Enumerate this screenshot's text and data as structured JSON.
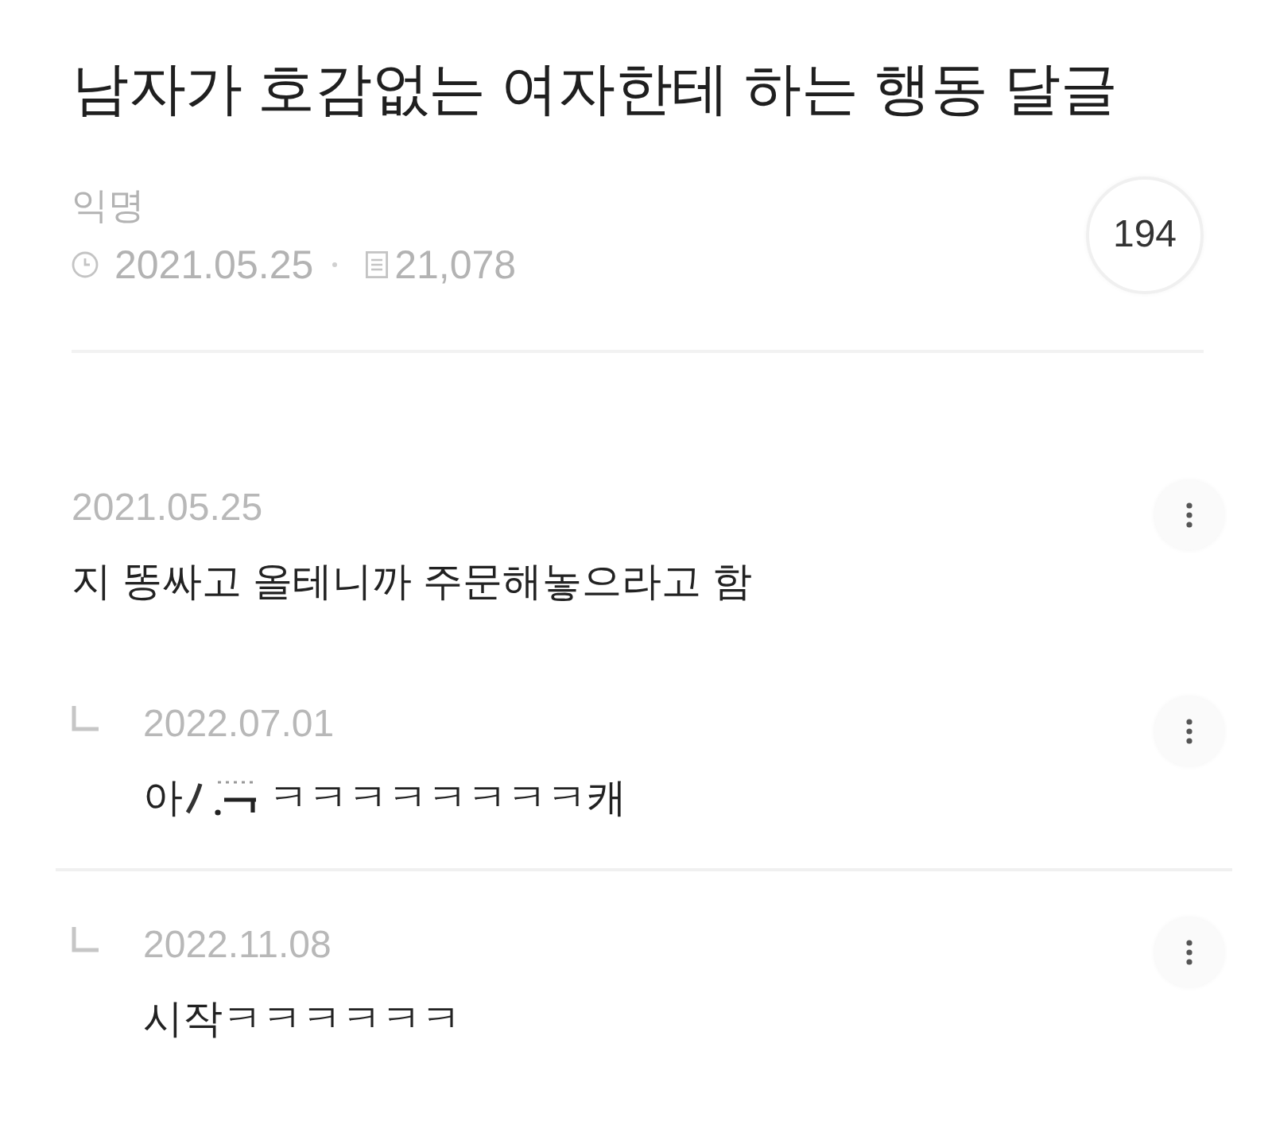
{
  "post": {
    "title": "남자가 호감없는 여자한테 하는 행동 달글",
    "author": "익명",
    "date": "2021.05.25",
    "views": "21,078",
    "comment_count": "194"
  },
  "comments": [
    {
      "date": "2021.05.25",
      "text": "지 똥싸고 올테니까 주문해놓으라고 함",
      "children": [
        {
          "date": "2022.07.01",
          "segments": [
            {
              "kind": "text",
              "text": "아"
            },
            {
              "kind": "erased"
            },
            {
              "kind": "text",
              "text": "ㅋㅋㅋㅋㅋㅋㅋㅋ캐"
            }
          ]
        },
        {
          "date": "2022.11.08",
          "text": "시작ㅋㅋㅋㅋㅋㅋ"
        }
      ]
    }
  ]
}
